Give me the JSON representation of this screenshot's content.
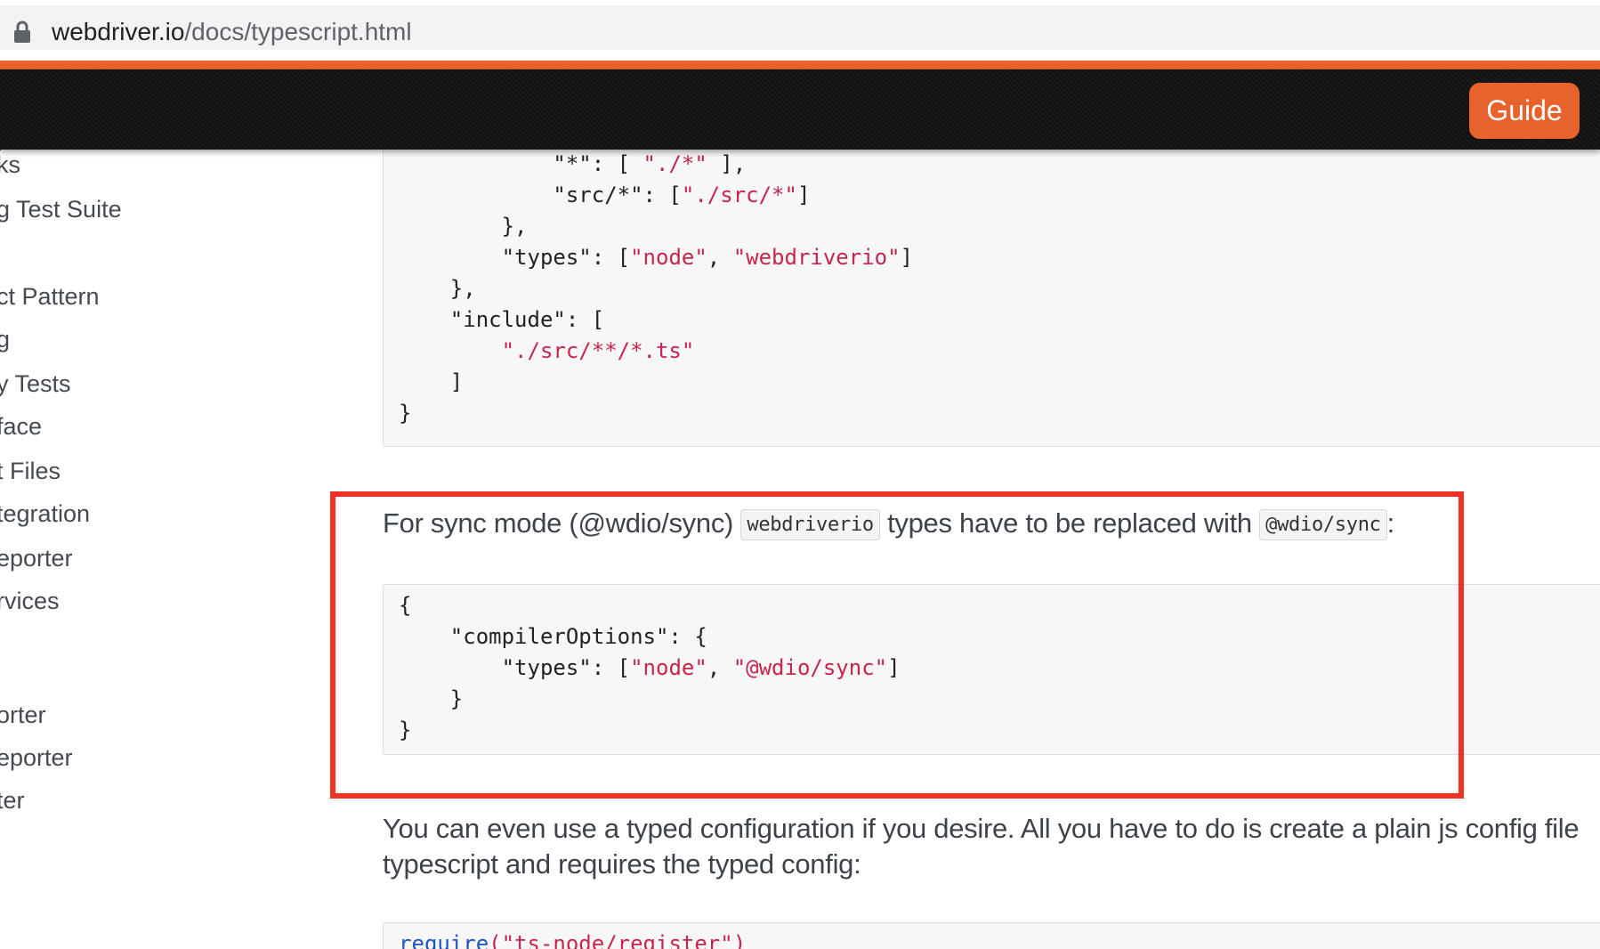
{
  "browser": {
    "url_host": "webdriver.io",
    "url_path": "/docs/typescript.html"
  },
  "header": {
    "guide_label": "Guide"
  },
  "sidebar": {
    "items": [
      {
        "label": "ks"
      },
      {
        "label": "g Test Suite"
      },
      {
        "label": "ct Pattern"
      },
      {
        "label": "g"
      },
      {
        "label": "y Tests"
      },
      {
        "label": "face"
      },
      {
        "label": "t Files"
      },
      {
        "label": "tegration"
      },
      {
        "label": "eporter"
      },
      {
        "label": "rvices"
      },
      {
        "label": "orter"
      },
      {
        "label": "eporter"
      },
      {
        "label": "ter"
      }
    ]
  },
  "code_block_1": {
    "lines": [
      {
        "pre": "            \"*\": [ ",
        "str": "\"./*\"",
        "post": " ],"
      },
      {
        "pre": "            \"src/*\": [",
        "str": "\"./src/*\"",
        "post": "]"
      },
      {
        "pre": "        },",
        "str": "",
        "post": ""
      },
      {
        "pre": "        \"types\": [",
        "str": "\"node\"",
        "post": ", ",
        "str2": "\"webdriverio\"",
        "post2": "]"
      },
      {
        "pre": "    },",
        "str": "",
        "post": ""
      },
      {
        "pre": "    \"include\": [",
        "str": "",
        "post": ""
      },
      {
        "pre": "        ",
        "str": "\"./src/**/*.ts\"",
        "post": ""
      },
      {
        "pre": "    ]",
        "str": "",
        "post": ""
      },
      {
        "pre": "}",
        "str": "",
        "post": ""
      }
    ]
  },
  "sync_paragraph": {
    "text_before": "For sync mode (@wdio/sync) ",
    "code_1": "webdriverio",
    "text_middle": " types have to be replaced with ",
    "code_2": "@wdio/sync",
    "text_after": ":"
  },
  "code_block_2": {
    "lines": [
      {
        "pre": "{",
        "str": "",
        "post": ""
      },
      {
        "pre": "    \"compilerOptions\": {",
        "str": "",
        "post": ""
      },
      {
        "pre": "        \"types\": [",
        "str": "\"node\"",
        "post": ", ",
        "str2": "\"@wdio/sync\"",
        "post2": "]"
      },
      {
        "pre": "    }",
        "str": "",
        "post": ""
      },
      {
        "pre": "}",
        "str": "",
        "post": ""
      }
    ]
  },
  "config_paragraph": {
    "line_1": "You can even use a typed configuration if you desire. All you have to do is create a plain js config file",
    "line_2": "typescript and requires the typed config:"
  },
  "code_block_3": {
    "fn": "require",
    "str": "(\"ts-node/register\")"
  },
  "colors": {
    "accent_orange": "#e8632b",
    "highlight_red": "#ee3124",
    "string_red": "#c7254e"
  },
  "icons": {
    "lock": "lock-icon"
  }
}
